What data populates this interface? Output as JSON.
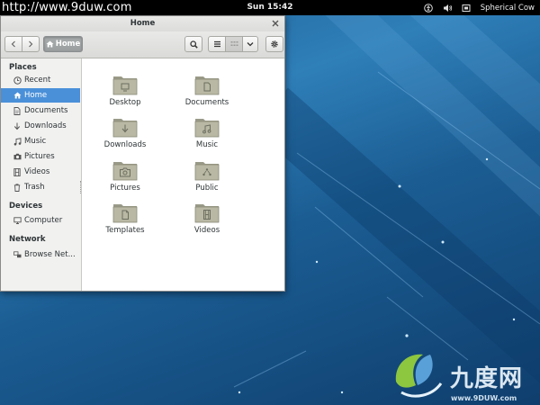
{
  "watermark_url": "http://www.9duw.com",
  "topbar": {
    "clock": "Sun 15:42",
    "user": "Spherical Cow",
    "icons": [
      "accessibility-icon",
      "volume-icon",
      "user-icon"
    ]
  },
  "window": {
    "title": "Home",
    "path_button": "Home",
    "sidebar": {
      "places_heading": "Places",
      "places": [
        {
          "label": "Recent",
          "icon": "clock-icon"
        },
        {
          "label": "Home",
          "icon": "home-icon",
          "active": true
        },
        {
          "label": "Documents",
          "icon": "document-icon"
        },
        {
          "label": "Downloads",
          "icon": "download-icon"
        },
        {
          "label": "Music",
          "icon": "music-icon"
        },
        {
          "label": "Pictures",
          "icon": "camera-icon"
        },
        {
          "label": "Videos",
          "icon": "film-icon"
        },
        {
          "label": "Trash",
          "icon": "trash-icon"
        }
      ],
      "devices_heading": "Devices",
      "devices": [
        {
          "label": "Computer",
          "icon": "computer-icon"
        }
      ],
      "network_heading": "Network",
      "network": [
        {
          "label": "Browse Net...",
          "icon": "network-icon"
        }
      ]
    },
    "files": [
      {
        "label": "Desktop",
        "emblem": "desktop"
      },
      {
        "label": "Documents",
        "emblem": "documents"
      },
      {
        "label": "Downloads",
        "emblem": "downloads"
      },
      {
        "label": "Music",
        "emblem": "music"
      },
      {
        "label": "Pictures",
        "emblem": "pictures"
      },
      {
        "label": "Public",
        "emblem": "public"
      },
      {
        "label": "Templates",
        "emblem": "templates"
      },
      {
        "label": "Videos",
        "emblem": "videos"
      }
    ]
  },
  "logo": {
    "text": "九度网",
    "url": "www.9DUW.com"
  }
}
